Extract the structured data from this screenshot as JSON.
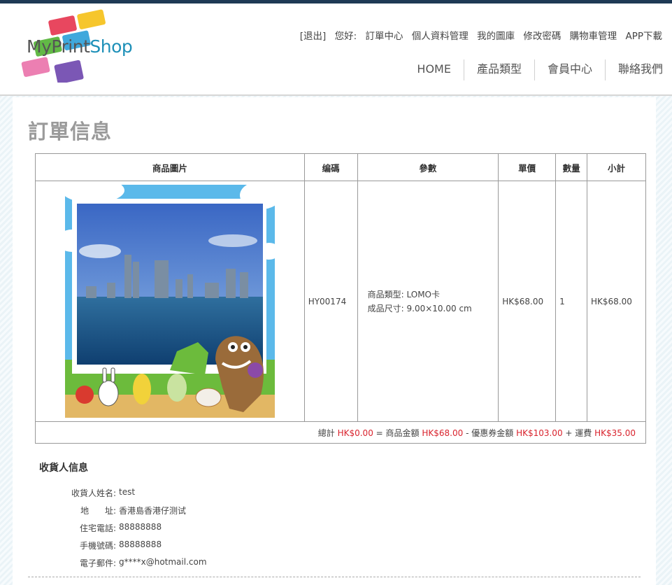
{
  "brand": {
    "logo_my": "MyPrint",
    "logo_shop": "Shop"
  },
  "user_links": {
    "logout": "[退出]",
    "greeting": "您好:",
    "order_center": "訂單中心",
    "profile": "個人資料管理",
    "gallery": "我的圖庫",
    "change_password": "修改密碼",
    "cart": "購物車管理",
    "app_download": "APP下載"
  },
  "nav": {
    "home": "HOME",
    "products": "產品類型",
    "member": "會員中心",
    "contact": "聯絡我們"
  },
  "page_title": "訂單信息",
  "table": {
    "headers": {
      "image": "商品圖片",
      "code": "编碼",
      "params": "參數",
      "unit_price": "單價",
      "qty": "數量",
      "subtotal": "小計"
    },
    "row": {
      "code": "HY00174",
      "param_type_label": "商品類型:",
      "param_type_value": "LOMO卡",
      "param_size_label": "成品尺寸:",
      "param_size_value": "9.00×10.00 cm",
      "unit_price": "HK$68.00",
      "qty": "1",
      "subtotal": "HK$68.00"
    },
    "total": {
      "total_label": "總計",
      "total_value": "HK$0.00",
      "eq": "= 商品金額",
      "goods_value": "HK$68.00",
      "minus": "- 優惠券金額",
      "coupon_value": "HK$103.00",
      "plus": "+ 運費",
      "shipping_value": "HK$35.00"
    }
  },
  "recipient": {
    "title": "收貨人信息",
    "fields": [
      {
        "label": "收貨人姓名:",
        "value": "test"
      },
      {
        "label": "地      址:",
        "value": "香港島香港仔测试"
      },
      {
        "label": "住宅電話:",
        "value": "88888888"
      },
      {
        "label": "手機號碼:",
        "value": "88888888"
      },
      {
        "label": "電子郵件:",
        "value": "g****x@hotmail.com"
      }
    ]
  },
  "colors": {
    "accent_red": "#d9232d",
    "top_bar": "#1f3a55",
    "brand_blue": "#1e90b8"
  }
}
